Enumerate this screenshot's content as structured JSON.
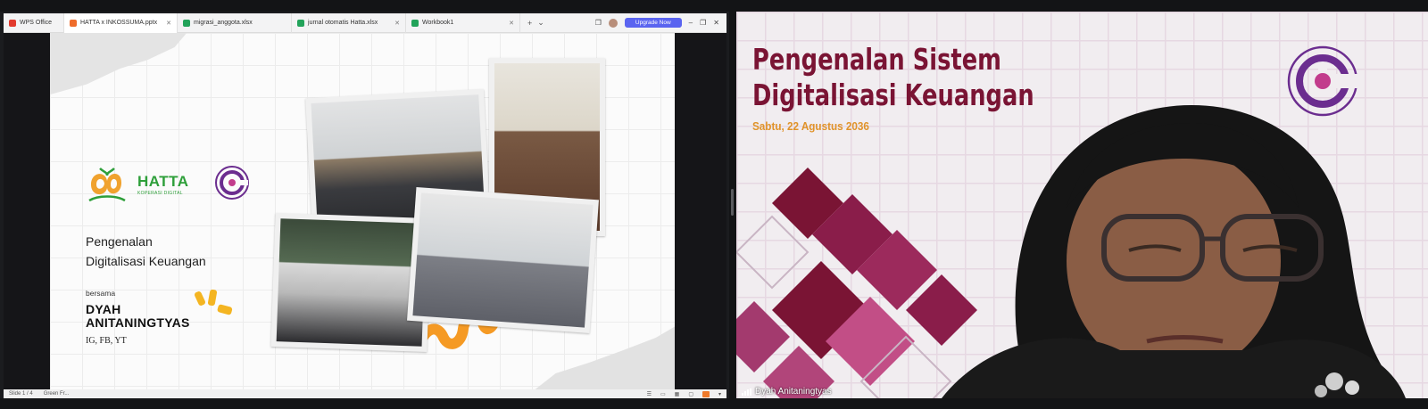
{
  "tabs": [
    {
      "label": "WPS Office",
      "icon_color": "#e23b2e",
      "active": false
    },
    {
      "label": "HATTA x INKOSSUMA.pptx",
      "icon_color": "#ef6c2b",
      "active": true
    },
    {
      "label": "migrasi_anggota.xlsx",
      "icon_color": "#22a35a",
      "active": false
    },
    {
      "label": "jurnal otomatis Hatta.xlsx",
      "icon_color": "#22a35a",
      "active": false
    },
    {
      "label": "Workbook1",
      "icon_color": "#22a35a",
      "active": false
    }
  ],
  "toolbar": {
    "new_tab": "+",
    "tab_menu": "⌄",
    "upgrade_label": "Upgrade Now"
  },
  "window_controls": {
    "minimize": "–",
    "restore": "❐",
    "close": "✕"
  },
  "slide": {
    "hatta_name": "HATTA",
    "hatta_sub": "KOPERASI DIGITAL",
    "title_line1": "Pengenalan",
    "title_line2": "Digitalisasi Keuangan",
    "with_label": "bersama",
    "presenter_line1": "DYAH",
    "presenter_line2": "ANITANINGTYAS",
    "social": "IG, FB, YT"
  },
  "statusbar": {
    "slide_indicator": "Slide 1 / 4",
    "theme": "Green Fr..."
  },
  "camera": {
    "title_line1": "Pengenalan Sistem",
    "title_line2": "Digitalisasi Keuangan",
    "date": "Sabtu, 22 Agustus 2036",
    "participant_name": "Dyah Anitaningtyas"
  },
  "colors": {
    "accent_maroon": "#7a1434",
    "accent_orange": "#e0932a",
    "hatta_green": "#2e9f3a",
    "inkos_purple": "#6b2d8f",
    "upgrade_blue": "#5a64f0"
  }
}
